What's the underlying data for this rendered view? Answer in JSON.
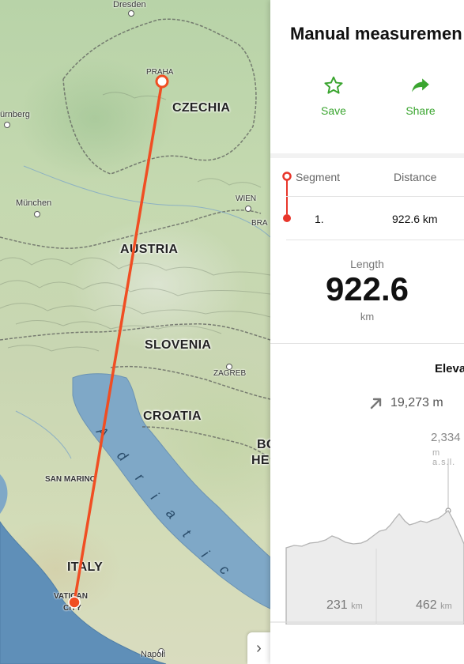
{
  "map": {
    "cities": {
      "dresden": "Dresden",
      "praha": "PRAHA",
      "nurnberg": "ürnberg",
      "munchen": "München",
      "wien": "WIEN",
      "bratislava": "BRA",
      "zagreb": "ZAGREB",
      "san_marino": "SAN MARINO",
      "vatican": "VATICAN",
      "city": "CITY",
      "napoli": "Napoli"
    },
    "countries": {
      "czechia": "CZECHIA",
      "austria": "AUSTRIA",
      "slovenia": "SLOVENIA",
      "croatia": "CROATIA",
      "italy": "ITALY",
      "bih_1": "BO",
      "bih_2": "HE"
    },
    "sea_letters": [
      "A",
      "d",
      "r",
      "i",
      "a",
      "t",
      "i",
      "c"
    ],
    "route_color": "#f04e23"
  },
  "panel": {
    "title": "Manual measuremen",
    "actions": [
      {
        "label": "Save",
        "icon": "star-outline-icon"
      },
      {
        "label": "Share",
        "icon": "share-arrow-icon"
      }
    ],
    "segments": {
      "headers": {
        "segment": "Segment",
        "distance": "Distance"
      },
      "rows": [
        {
          "index": "1.",
          "distance": "922.6 km"
        }
      ]
    },
    "length": {
      "label": "Length",
      "value": "922.6",
      "unit": "km"
    },
    "elevation": {
      "title": "Eleva",
      "ascent": "19,273 m",
      "peak_value": "2,334",
      "peak_unit": "m a.s.l.",
      "axis": [
        {
          "value": "231",
          "unit": "km"
        },
        {
          "value": "462",
          "unit": "km"
        }
      ]
    },
    "accent_color": "#3aa52f",
    "collapse_glyph": "›"
  }
}
